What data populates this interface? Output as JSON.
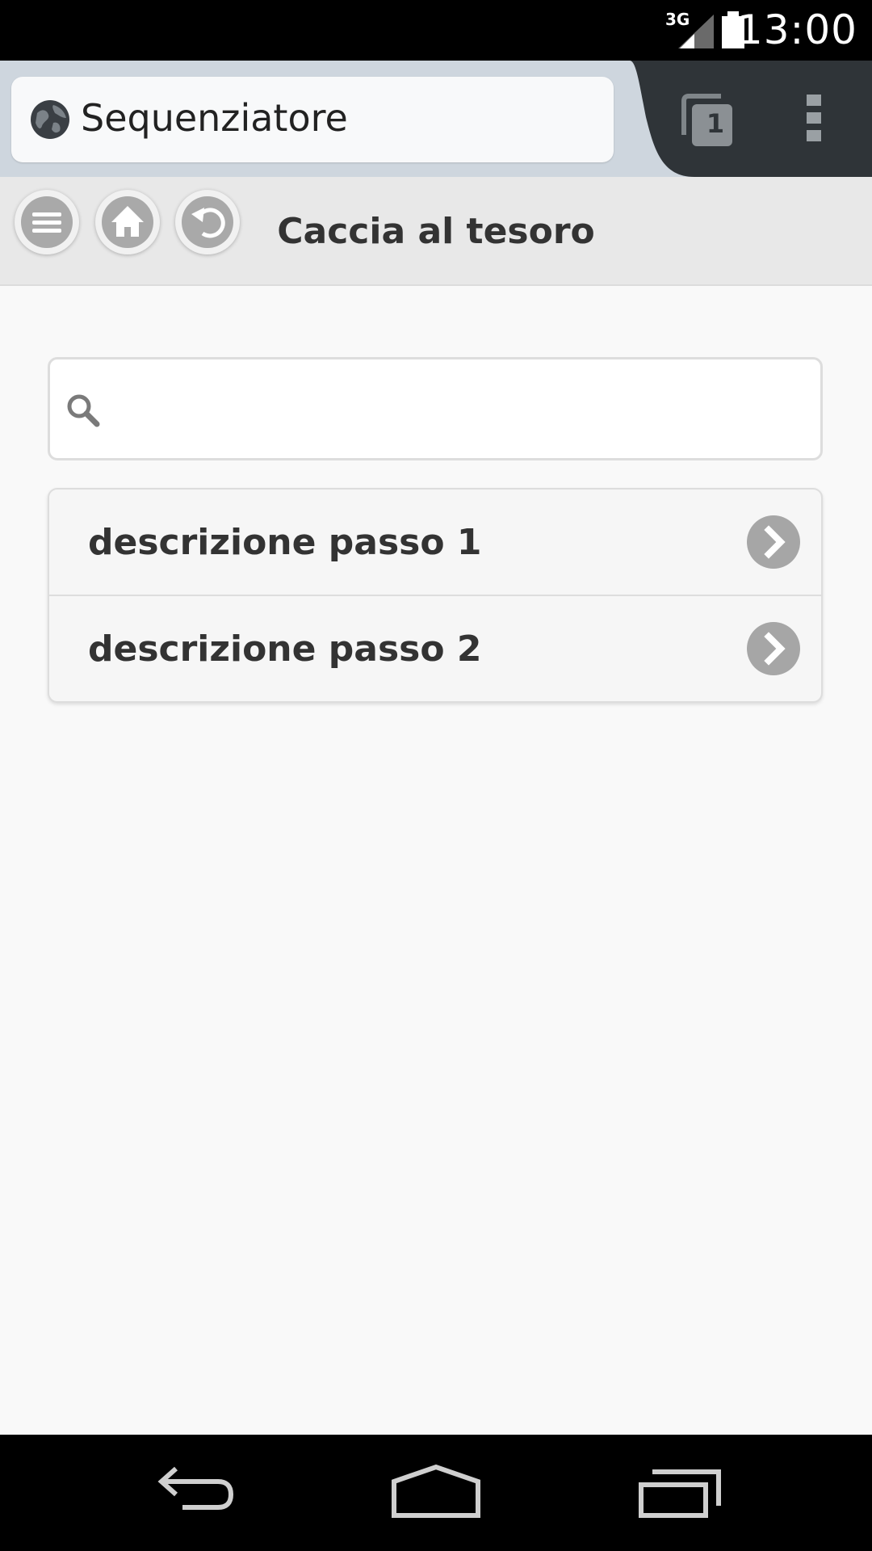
{
  "status_bar": {
    "network": "3G",
    "time": "13:00"
  },
  "browser": {
    "url_text": "Sequenziatore",
    "tab_count": "1"
  },
  "header": {
    "title": "Caccia al tesoro"
  },
  "search": {
    "value": "",
    "placeholder": ""
  },
  "list": {
    "items": [
      {
        "label": "descrizione passo 1"
      },
      {
        "label": "descrizione passo 2"
      }
    ]
  },
  "colors": {
    "status_bar": "#000000",
    "browser_bar": "#ced6de",
    "browser_dark": "#2f3438",
    "header_bg": "#e8e8e8",
    "page_bg": "#f9f9f9",
    "icon_grey": "#a9a9a9"
  }
}
